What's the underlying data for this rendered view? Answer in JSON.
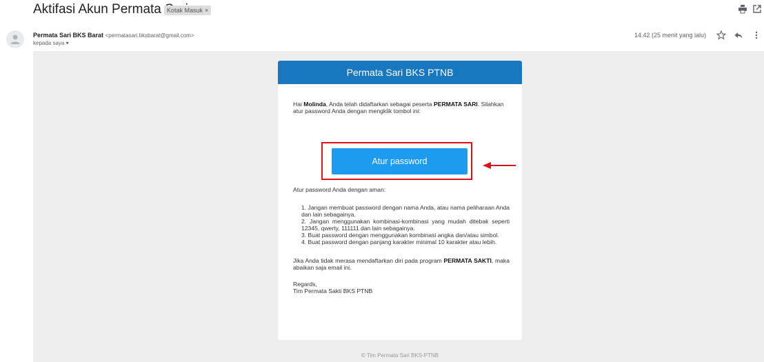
{
  "subject": "Aktifasi Akun Permata Sari",
  "label_chip": {
    "text": "Kotak Masuk",
    "close": "×"
  },
  "top_actions": [
    "print-icon",
    "open-new-window-icon"
  ],
  "sender": {
    "name": "Permata Sari BKS Barat",
    "email": "<permatasari.bksbarat@gmail.com>",
    "to": "kepada saya ▾"
  },
  "time": "14.42 (25 menit yang lalu)",
  "header_actions": [
    "star-icon",
    "reply-icon",
    "more-vert-icon"
  ],
  "email": {
    "header_title": "Permata Sari BKS PTNB",
    "intro_greeting": "Hai ",
    "intro_name": "Molinda",
    "intro_text": ", Anda telah didaftarkan sebagai peserta ",
    "intro_program": "PERMATA SARI",
    "intro_tail": ". Silahkan atur password Anda dengan mengklik tombol ini:",
    "button_label": "Atur password",
    "tips_title": "Atur password Anda dengan aman:",
    "tips": [
      "1. Jangan membuat password dengan nama Anda, atau nama peliharaan Anda dan lain sebagainya.",
      "2. Jangan menggunakan kombinasi-kombinasi yang mudah ditebak seperti 12345, qwerty, 111111 dan lain sebagainya.",
      "3. Buat password dengan menggunakan kombinasi angka dan/atau simbol.",
      "4. Buat password dengan panjang karakter minimal 10 karakter atau lebih."
    ],
    "closing_text": "Jika Anda tidak merasa mendaftarkan diri pada program ",
    "closing_program": "PERMATA SAKTI",
    "closing_tail": ", maka abaikan saja email ini.",
    "regards_line1": "Regards,",
    "regards_line2": "Tim Permata Sakti BKS PTNB",
    "footer": "© Tim Permata Sari BKS-PTNB"
  },
  "colors": {
    "header_blue": "#1877bf",
    "button_blue": "#1d9bf0",
    "highlight_red": "#e0101a",
    "mail_background": "#eeeeee"
  }
}
